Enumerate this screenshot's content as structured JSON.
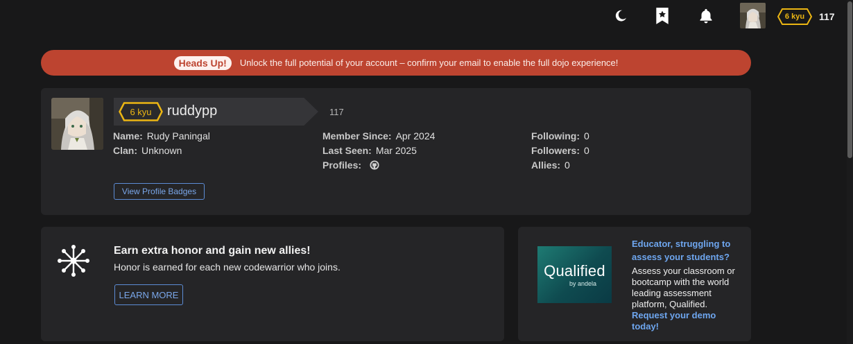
{
  "topbar": {
    "theme_icon": "moon-icon",
    "bookmark_icon": "bookmark-star-icon",
    "notifications_icon": "bell-icon",
    "rank": "6 kyu",
    "honor": "117"
  },
  "alert": {
    "pill": "Heads Up!",
    "message": "Unlock the full potential of your account – confirm your email to enable the full dojo experience!"
  },
  "profile": {
    "rank": "6 kyu",
    "username": "ruddypp",
    "honor": "117",
    "name_label": "Name:",
    "name_value": "Rudy Paningal",
    "clan_label": "Clan:",
    "clan_value": "Unknown",
    "member_since_label": "Member Since:",
    "member_since_value": "Apr 2024",
    "last_seen_label": "Last Seen:",
    "last_seen_value": "Mar 2025",
    "profiles_label": "Profiles:",
    "following_label": "Following:",
    "following_value": "0",
    "followers_label": "Followers:",
    "followers_value": "0",
    "allies_label": "Allies:",
    "allies_value": "0",
    "badges_button": "View Profile Badges"
  },
  "referral": {
    "title": "Earn extra honor and gain new allies!",
    "subtitle": "Honor is earned for each new codewarrior who joins.",
    "button": "LEARN MORE"
  },
  "ad": {
    "logo_main": "Qualified",
    "logo_sub": "by andela",
    "title": "Educator, struggling to assess your students?",
    "body": "Assess your classroom or bootcamp with the world leading assessment platform, Qualified.",
    "link": "Request your demo today!"
  },
  "colors": {
    "background": "#181819",
    "card": "#252527",
    "alert": "#bd4430",
    "rank_yellow": "#ecb613",
    "link_blue": "#6ea6ef"
  }
}
